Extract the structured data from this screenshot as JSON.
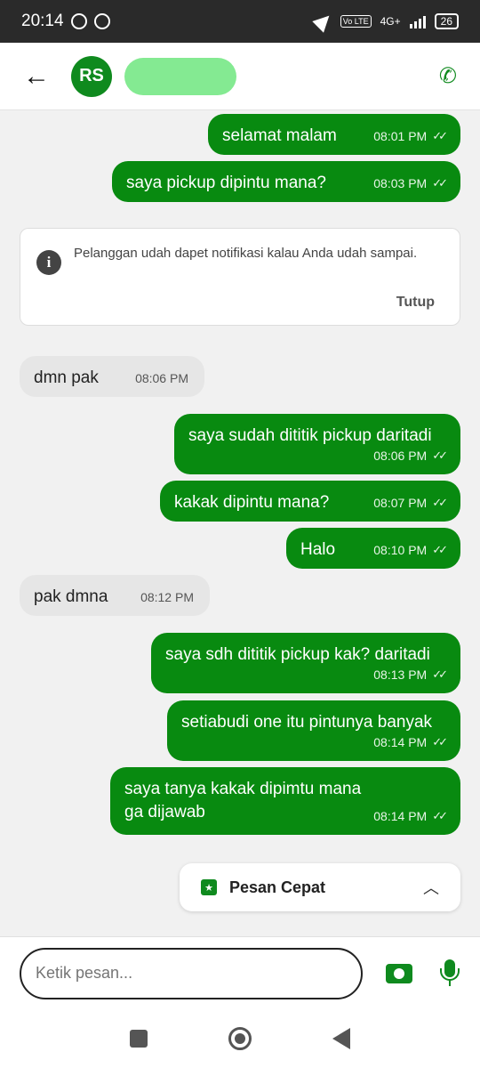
{
  "status": {
    "time": "20:14",
    "network": "4G+",
    "volte": "Vo LTE",
    "battery": "26"
  },
  "header": {
    "avatar_initials": "RS"
  },
  "messages": [
    {
      "text": "selamat malam",
      "time": "08:01 PM"
    },
    {
      "text": "saya pickup dipintu mana?",
      "time": "08:03 PM"
    },
    {
      "text": "dmn pak",
      "time": "08:06 PM"
    },
    {
      "text": "saya sudah dititik pickup daritadi",
      "time": "08:06 PM"
    },
    {
      "text": "kakak dipintu mana?",
      "time": "08:07 PM"
    },
    {
      "text": "Halo",
      "time": "08:10 PM"
    },
    {
      "text": "pak dmna",
      "time": "08:12 PM"
    },
    {
      "text": "saya sdh dititik pickup kak? daritadi",
      "time": "08:13 PM"
    },
    {
      "text": "setiabudi one itu pintunya banyak",
      "time": "08:14 PM"
    },
    {
      "text": "saya tanya kakak dipimtu mana ga dijawab",
      "time": "08:14 PM"
    }
  ],
  "notice": {
    "text": "Pelanggan udah dapet notifikasi kalau Anda udah sampai.",
    "close_label": "Tutup"
  },
  "quick_reply": {
    "label": "Pesan Cepat"
  },
  "input": {
    "placeholder": "Ketik pesan..."
  },
  "colors": {
    "accent": "#0f8a1e",
    "outgoing_bubble": "#088a10",
    "incoming_bubble": "#e6e6e6"
  }
}
